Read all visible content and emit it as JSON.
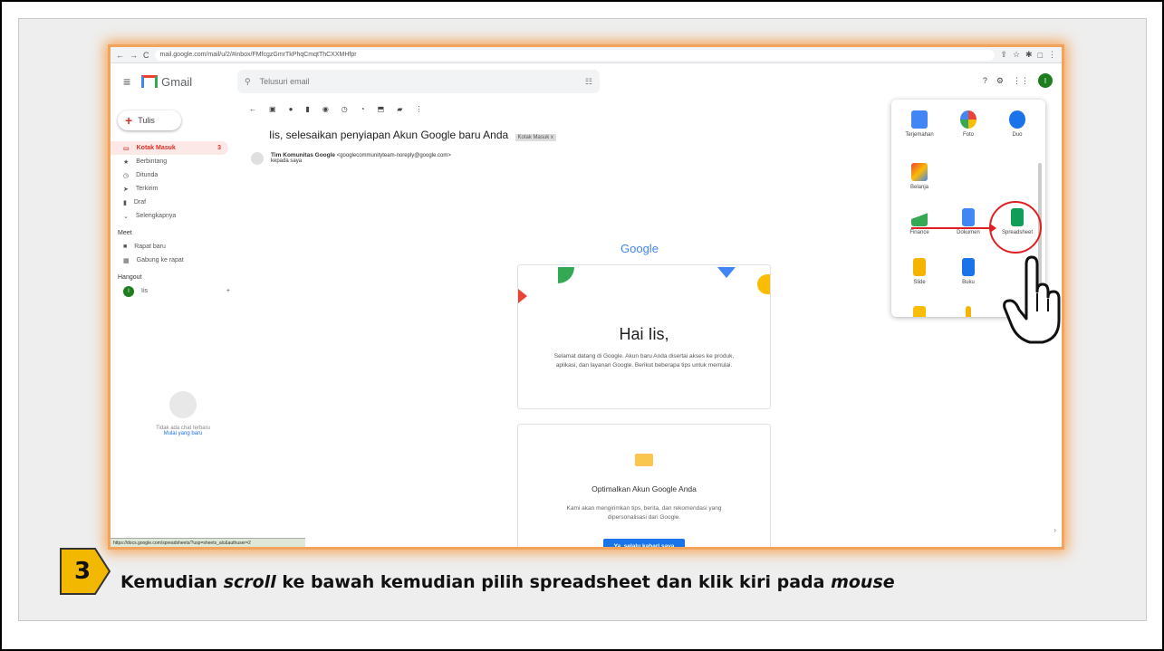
{
  "browser": {
    "url": "mail.google.com/mail/u/2/#inbox/FMfcgzGmrTkPhqCmqtThCXXMHfpr"
  },
  "gmail": {
    "logo_text": "Gmail",
    "search_placeholder": "Telusuri email",
    "avatar_letter": "I",
    "compose_label": "Tulis",
    "nav": [
      {
        "label": "Kotak Masuk",
        "count": "3",
        "icon": "inbox-icon"
      },
      {
        "label": "Berbintang",
        "icon": "star-icon"
      },
      {
        "label": "Ditunda",
        "icon": "clock-icon"
      },
      {
        "label": "Terkirim",
        "icon": "send-icon"
      },
      {
        "label": "Draf",
        "icon": "draft-icon"
      },
      {
        "label": "Selengkapnya",
        "icon": "chevron-down-icon"
      }
    ],
    "meet_header": "Meet",
    "meet_items": [
      {
        "label": "Rapat baru",
        "icon": "video-icon"
      },
      {
        "label": "Gabung ke rapat",
        "icon": "keyboard-icon"
      }
    ],
    "hangout_header": "Hangout",
    "hangout_user": "Iis",
    "hangout_empty": "Tidak ada chat terbaru",
    "hangout_link": "Mulai yang baru",
    "status_url": "https://docs.google.com/spreadsheets/?usp=sheets_alc&authuser=2"
  },
  "email": {
    "subject": "Iis, selesaikan penyiapan Akun Google baru Anda",
    "tag": "Kotak Masuk x",
    "sender_name": "Tim Komunitas Google",
    "sender_email": "<googlecommunityteam-noreply@google.com>",
    "to": "kepada saya",
    "google_logo": "Google",
    "greeting": "Hai Iis,",
    "body": "Selamat datang di Google. Akun baru Anda disertai akses ke produk, aplikasi, dan layanan Google. Berikut beberapa tips untuk memulai.",
    "card2_title": "Optimalkan Akun Google Anda",
    "card2_body": "Kami akan mengirimkan tips, berita, dan rekomendasi yang dipersonalisasi dari Google.",
    "card2_button": "Ya, selalu kabari saya"
  },
  "apps": [
    {
      "label": "Terjemahan",
      "color": "#4285f4"
    },
    {
      "label": "Foto",
      "color": "#fbbc04"
    },
    {
      "label": "Duo",
      "color": "#1a73e8"
    },
    {
      "label": "Belanja",
      "color": "#ea4335"
    },
    {
      "label": "Finance",
      "color": "#34a853"
    },
    {
      "label": "Dokumen",
      "color": "#4285f4"
    },
    {
      "label": "Spreadsheet",
      "color": "#0f9d58"
    },
    {
      "label": "Slide",
      "color": "#f4b400"
    },
    {
      "label": "Buku",
      "color": "#1a73e8"
    }
  ],
  "step": {
    "number": "3",
    "text_1": "Kemudian ",
    "text_2": "scroll",
    "text_3": " ke bawah kemudian pilih spreadsheet dan klik kiri pada ",
    "text_4": "mouse",
    "badge_color": "#f2b800"
  }
}
